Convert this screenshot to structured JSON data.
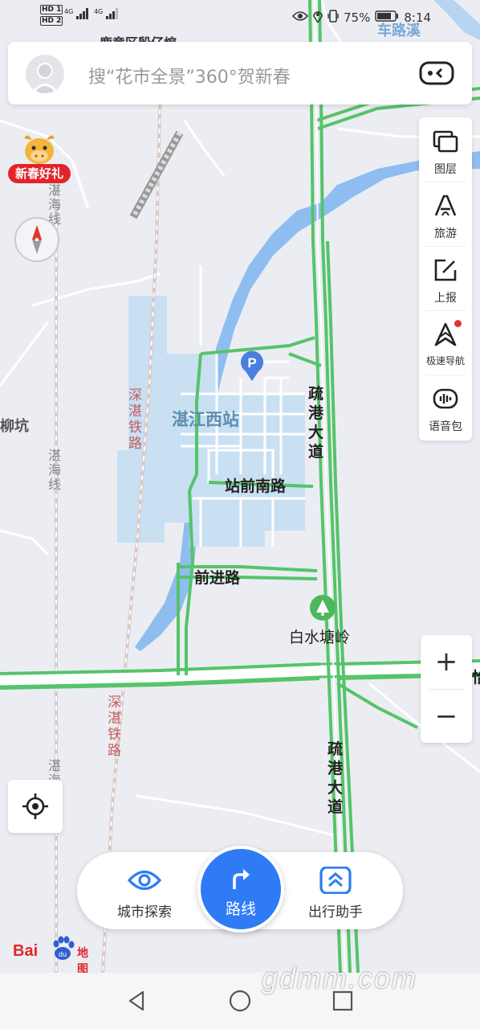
{
  "status_bar": {
    "hd1": "HD 1",
    "hd2": "HD 2",
    "network1": "4G",
    "network2": "4G",
    "battery": "75%",
    "time": "8:14"
  },
  "search": {
    "placeholder": "搜“花市全景”360°贺新春"
  },
  "promo": {
    "label": "新春好礼"
  },
  "toolbar": {
    "layers": "图层",
    "travel": "旅游",
    "report": "上报",
    "fast_nav": "极速导航",
    "voice_pack": "语音包"
  },
  "map_labels": {
    "top_partial": "鹿章区殷仔熔",
    "top_right_partial": "车路溪",
    "zhanjiang_west": "湛江西站",
    "shugang_road_1": "疏港大道",
    "shugang_road_2": "疏港大道",
    "zhanqian_south": "站前南路",
    "qianjin_road": "前进路",
    "baishui_tangling": "白水塘岭",
    "shenzhan_rail_1": "深湛铁路",
    "shenzhan_rail_2": "深湛铁路",
    "zhanhai_line_1": "湛海线",
    "zhanhai_line_2": "湛海线",
    "zhanhai_line_3": "湛海线",
    "liukeng": "柳坑",
    "right_edge_partial": "怡"
  },
  "zoom": {
    "plus": "+",
    "minus": "−"
  },
  "bottom_nav": {
    "city_explore": "城市探索",
    "route": "路线",
    "travel_assistant": "出行助手"
  },
  "logo": {
    "bai": "Bai",
    "ditu": "地图"
  },
  "watermark": "gdmm.com",
  "icons": {
    "layers": "layers-icon",
    "travel": "travel-icon",
    "report": "report-icon",
    "fast_nav": "navigation-arrow-icon",
    "voice": "voice-icon",
    "locate": "locate-icon",
    "compass": "compass-icon",
    "explore": "eye-icon",
    "assistant": "assistant-icon",
    "route": "route-arrow-icon",
    "parking": "parking-icon",
    "landmark": "tree-landmark-icon"
  },
  "colors": {
    "accent": "#2f7bf5",
    "road_green": "#55c46a",
    "water": "#8ebdf0",
    "station_area": "#c9e0f3",
    "rail_label": "#c65c5c",
    "promo_red": "#e2252b"
  }
}
